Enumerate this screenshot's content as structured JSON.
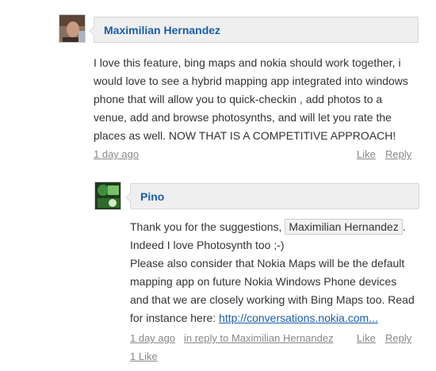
{
  "comment": {
    "author": "Maximilian Hernandez",
    "body": "I love this feature, bing maps and nokia should work together, i would love to see a hybrid mapping app integrated into windows phone that will allow you to quick-checkin , add photos to a venue, add and browse photosynths, and will let you rate the places as well.  NOW THAT IS A COMPETITIVE APPROACH!",
    "time": "1 day ago",
    "like_label": "Like",
    "reply_label": "Reply"
  },
  "reply": {
    "author": "Pino",
    "line1_prefix": "Thank you for the suggestions, ",
    "mention": "Maximilian Hernandez",
    "line1_suffix": ".",
    "line2": "Indeed I love Photosynth too ;-)",
    "line3": "Please also consider that Nokia Maps will be the default mapping app on future Nokia Windows Phone devices and that we are closely working with Bing Maps too. Read for instance here: ",
    "link_text": "http://conversations.nokia.com...",
    "time": "1 day ago",
    "in_reply_to": "in reply to Maximilian Hernandez",
    "like_label": "Like",
    "reply_label": "Reply",
    "likes_count": "1 Like"
  }
}
